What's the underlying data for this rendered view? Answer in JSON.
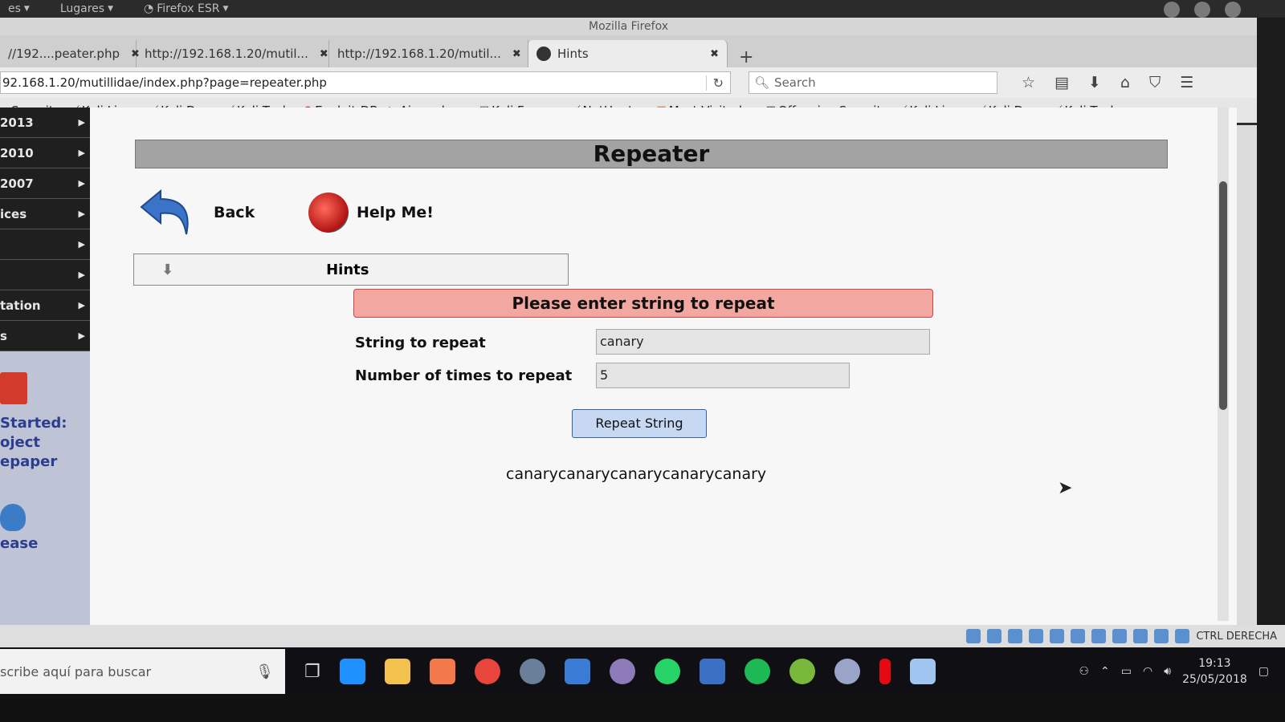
{
  "gnome": {
    "apps": "es",
    "places": "Lugares",
    "app": "Firefox ESR"
  },
  "window": {
    "title": "Mozilla Firefox"
  },
  "tabs": [
    {
      "label": "//192....peater.php"
    },
    {
      "label": "http://192.168.1.20/mutil..."
    },
    {
      "label": "http://192.168.1.20/mutil..."
    },
    {
      "label": "Hints"
    }
  ],
  "nav": {
    "url": "92.168.1.20/mutillidae/index.php?page=repeater.php",
    "search_placeholder": "Search"
  },
  "bookmarks": [
    "e Security",
    "Kali Linux",
    "Kali Docs",
    "Kali Tools",
    "Exploit-DB",
    "Aircrack-ng",
    "Kali Forums",
    "NetHunter",
    "Most Visited",
    "Offensive Security",
    "Kali Linux",
    "Kali Docs",
    "Kali Tools"
  ],
  "sidebar": {
    "items": [
      "2013",
      "2010",
      "2007",
      "ices",
      "",
      "",
      "tation",
      "s"
    ],
    "promo": [
      "Started:",
      "oject",
      "epaper"
    ],
    "release": "ease"
  },
  "page": {
    "title": "Repeater",
    "back_label": "Back",
    "help_label": "Help Me!",
    "hints_label": "Hints",
    "error": "Please enter string to repeat",
    "string_label": "String to repeat",
    "string_value": "canary",
    "times_label": "Number of times to repeat",
    "times_value": "5",
    "button": "Repeat String",
    "output": "canarycanarycanarycanarycanary"
  },
  "vbox": {
    "hostkey": "CTRL DERECHA"
  },
  "taskbar": {
    "search_placeholder": "scribe aquí para buscar",
    "time": "19:13",
    "date": "25/05/2018",
    "apps": [
      {
        "name": "edge-icon",
        "color": "#1e90ff"
      },
      {
        "name": "explorer-icon",
        "color": "#f2c14e"
      },
      {
        "name": "xampp-icon",
        "color": "#f27a4a"
      },
      {
        "name": "chrome-icon",
        "color": "#e8453c"
      },
      {
        "name": "dotnet-icon",
        "color": "#6a7f9a"
      },
      {
        "name": "vscode-icon",
        "color": "#3a7bd5"
      },
      {
        "name": "globe-icon",
        "color": "#8d7ab8"
      },
      {
        "name": "whatsapp-icon",
        "color": "#25d366"
      },
      {
        "name": "brackets-icon",
        "color": "#3b6fc4"
      },
      {
        "name": "spotify-icon",
        "color": "#1db954"
      },
      {
        "name": "utorrent-icon",
        "color": "#78b83a"
      },
      {
        "name": "vpn-icon",
        "color": "#9aa4c8"
      },
      {
        "name": "netflix-icon",
        "color": "#e50914"
      },
      {
        "name": "virtualbox-icon",
        "color": "#9ec6f0"
      }
    ]
  }
}
